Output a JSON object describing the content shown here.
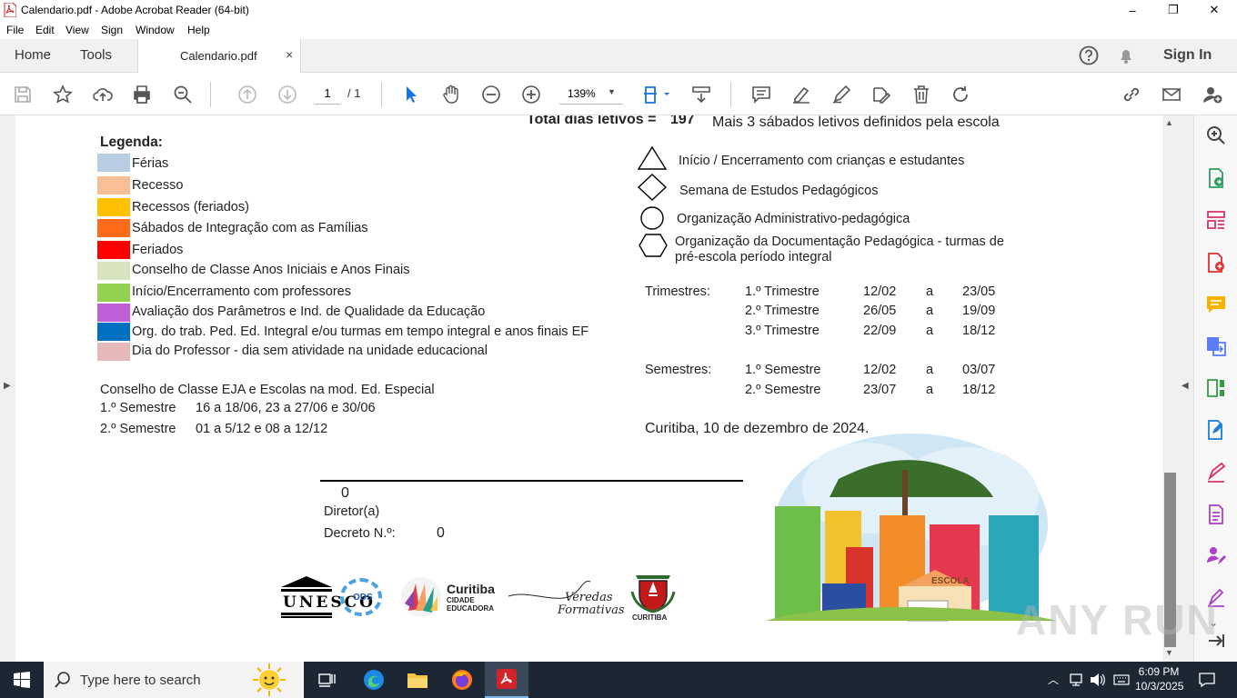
{
  "window": {
    "title": "Calendario.pdf - Adobe Acrobat Reader (64-bit)",
    "minimize": "–",
    "maximize": "❐",
    "close": "✕"
  },
  "menu": [
    "File",
    "Edit",
    "View",
    "Sign",
    "Window",
    "Help"
  ],
  "tabs": {
    "home": "Home",
    "tools": "Tools",
    "document": "Calendario.pdf",
    "close": "×",
    "sign_in": "Sign In"
  },
  "toolbar": {
    "page_current": "1",
    "page_total": "/ 1",
    "zoom": "139%"
  },
  "doc": {
    "total_label": "Total dias letivos =",
    "total_value": "197",
    "extra_saturdays": "Mais 3 sábados letivos definidos pela escola",
    "legend_title": "Legenda:",
    "legend": [
      {
        "label": "Férias",
        "color": "#b8cce4"
      },
      {
        "label": "Recesso",
        "color": "#f7bf95"
      },
      {
        "label": "Recessos (feriados)",
        "color": "#ffc000"
      },
      {
        "label": "Sábados de Integração com as Famílias",
        "color": "#ff6b1a"
      },
      {
        "label": "Feriados",
        "color": "#ff0000"
      },
      {
        "label": "Conselho de Classe Anos Iniciais e Anos Finais",
        "color": "#d7e4bd"
      },
      {
        "label": "Início/Encerramento com professores",
        "color": "#92d050"
      },
      {
        "label": "Avaliação dos Parâmetros e Ind. de Qualidade da Educação",
        "color": "#c060d8"
      },
      {
        "label": "Org. do trab. Ped. Ed. Integral e/ou turmas em tempo integral e anos finais EF",
        "color": "#0070c0"
      },
      {
        "label": "Dia do Professor -  dia sem atividade na unidade educacional",
        "color": "#e6b9b8"
      }
    ],
    "symbols": [
      {
        "shape": "triangle",
        "label": "Início / Encerramento com crianças e estudantes"
      },
      {
        "shape": "diamond",
        "label": "Semana de Estudos Pedagógicos"
      },
      {
        "shape": "circle",
        "label": "Organização Administrativo-pedagógica"
      },
      {
        "shape": "hexagon",
        "label": "Organização da Documentação Pedagógica - turmas de",
        "label2": "pré-escola período integral"
      }
    ],
    "trimestres_label": "Trimestres:",
    "trimestres": [
      {
        "name": "1.º Trimestre",
        "start": "12/02",
        "sep": "a",
        "end": "23/05"
      },
      {
        "name": "2.º Trimestre",
        "start": "26/05",
        "sep": "a",
        "end": "19/09"
      },
      {
        "name": "3.º Trimestre",
        "start": "22/09",
        "sep": "a",
        "end": "18/12"
      }
    ],
    "semestres_label": "Semestres:",
    "semestres": [
      {
        "name": "1.º Semestre",
        "start": "12/02",
        "sep": "a",
        "end": "03/07"
      },
      {
        "name": "2.º Semestre",
        "start": "23/07",
        "sep": "a",
        "end": "18/12"
      }
    ],
    "eja_title": "Conselho de Classe EJA e Escolas na mod. Ed. Especial",
    "eja": [
      {
        "name": "1.º Semestre",
        "dates": "16 a 18/06, 23 a 27/06 e 30/06"
      },
      {
        "name": "2.º Semestre",
        "dates": "01 a 5/12 e 08 a 12/12"
      }
    ],
    "city_date": "Curitiba, 10 de dezembro de 2024.",
    "signature_value": "0",
    "director_label": "Diretor(a)",
    "decree_label": "Decreto N.º:",
    "decree_value": "0",
    "logos": {
      "unesco": "UNESCO",
      "ods": "ODS",
      "curitiba": "Curitiba",
      "cidade": "CIDADE",
      "educadora": "EDUCADORA",
      "veredas": "Veredas",
      "formativas": "Formativas",
      "curitiba_seal": "CURITIBA",
      "escola": "ESCOLA"
    }
  },
  "taskbar": {
    "search_placeholder": "Type here to search",
    "time": "6:09 PM",
    "date": "10/3/2025"
  },
  "watermark": "ANY RUN"
}
